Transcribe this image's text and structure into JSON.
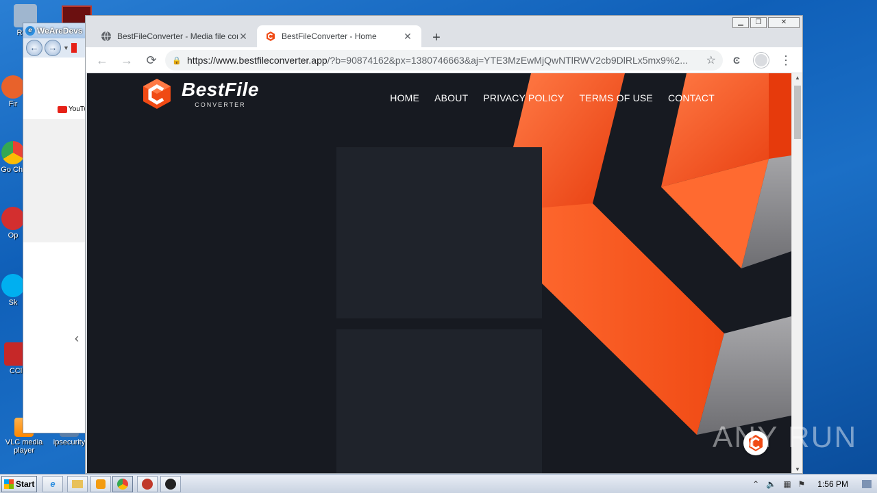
{
  "desktop": {
    "icons": [
      {
        "label": "Recy",
        "color": "#9fb6cf"
      },
      {
        "label": "Fir",
        "color": "#e8622b"
      },
      {
        "label": "Go\nChr",
        "color": "#34a853"
      },
      {
        "label": "Op",
        "color": "#d32f2f"
      },
      {
        "label": "Sk",
        "color": "#00aff0"
      },
      {
        "label": "CCl",
        "color": "#c62828"
      },
      {
        "label": "VLC media player",
        "color": "#ff8800"
      },
      {
        "label": "ipsecurity",
        "color": "#5a7ea8"
      }
    ]
  },
  "ie_window": {
    "title": "WeAreDevs",
    "youtube_label": "YouTu",
    "chevron": "‹"
  },
  "chrome": {
    "tabs": [
      {
        "title": "BestFileConverter - Media file conver",
        "active": false
      },
      {
        "title": "BestFileConverter - Home",
        "active": true
      }
    ],
    "new_tab": "+",
    "url_host": "https://www.bestfileconverter.app",
    "url_path": "/?b=90874162&px=1380746663&aj=YTE3MzEwMjQwNTlRWV2cb9DlRLx5mx9%2...",
    "window_buttons": {
      "minimize": "▁",
      "restore": "❐",
      "close": "✕"
    }
  },
  "page": {
    "brand_name": "BestFile",
    "brand_sub": "CONVERTER",
    "nav": [
      "HOME",
      "ABOUT",
      "PRIVACY POLICY",
      "TERMS OF USE",
      "CONTACT"
    ],
    "colors": {
      "bg": "#171a21",
      "accent": "#f04a14",
      "accent_light": "#ff7a45",
      "card": "#1f232b"
    }
  },
  "watermark": "ANY RUN",
  "taskbar": {
    "start_label": "Start",
    "time": "1:56 PM"
  }
}
